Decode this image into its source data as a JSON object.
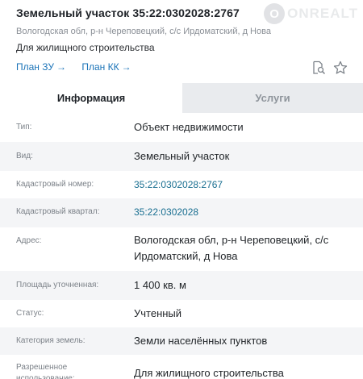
{
  "header": {
    "title": "Земельный участок 35:22:0302028:2767",
    "address": "Вологодская обл, р-н Череповецкий, с/с Ирдоматский, д Нова",
    "purpose": "Для жилищного строительства",
    "links": [
      {
        "label": "План ЗУ",
        "arrow": "→"
      },
      {
        "label": "План КК",
        "arrow": "→"
      }
    ],
    "watermark": {
      "logo_glyph": "O",
      "text": "ONREALT"
    }
  },
  "tabs": [
    {
      "label": "Информация",
      "active": true
    },
    {
      "label": "Услуги",
      "active": false
    }
  ],
  "details": [
    {
      "label": "Тип:",
      "value": "Объект недвижимости"
    },
    {
      "label": "Вид:",
      "value": "Земельный участок"
    },
    {
      "label": "Кадастровый номер:",
      "value": "35:22:0302028:2767"
    },
    {
      "label": "Кадастровый квартал:",
      "value": "35:22:0302028"
    },
    {
      "label": "Адрес:",
      "value": "Вологодская обл, р-н Череповецкий, с/с Ирдоматский, д Нова"
    },
    {
      "label": "Площадь уточненная:",
      "value": "1 400 кв. м"
    },
    {
      "label": "Статус:",
      "value": "Учтенный"
    },
    {
      "label": "Категория земель:",
      "value": "Земли населённых пунктов"
    },
    {
      "label": "Разрешенное использование:",
      "value": "Для жилищного строительства"
    }
  ],
  "colors": {
    "link": "#1a73b8",
    "cadastral_link": "#1a6f91",
    "inactive_tab_bg": "#e9ebee",
    "alt_row_bg": "#f4f5f7"
  },
  "icons": [
    "search-document-icon",
    "star-icon"
  ]
}
